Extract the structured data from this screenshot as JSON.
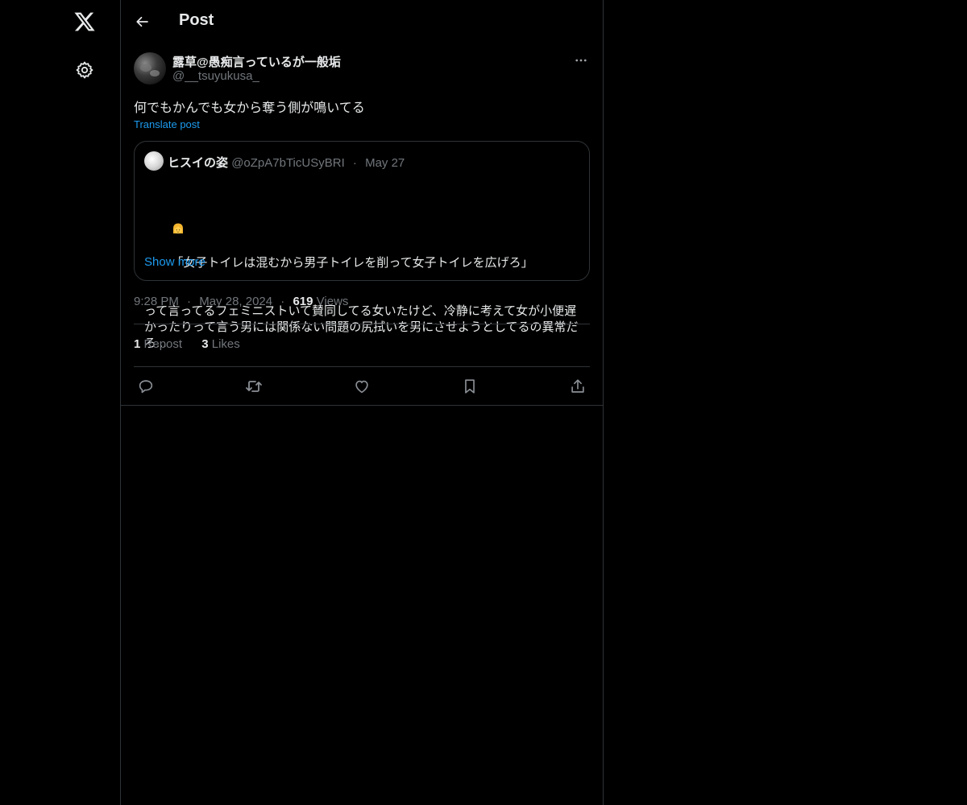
{
  "sidebar": {
    "logo_icon": "x-logo-icon",
    "settings_icon": "gear-icon"
  },
  "header": {
    "back_icon": "arrow-left-icon",
    "title": "Post"
  },
  "post": {
    "author_name": "露草@愚痴言っているが一般垢",
    "author_handle": "@__tsuyukusa_",
    "more_icon": "more-horizontal-icon",
    "text": "何でもかんでも女から奪う側が鳴いてる",
    "translate_label": "Translate post",
    "quote": {
      "name": "ヒスイの姿",
      "handle": "@oZpA7bTicUSyBRI",
      "date": "May 27",
      "line1": "「女子トイレは混むから男子トイレを削って女子トイレを広げろ」",
      "line2": "って言ってるフェミニストいて賛同してる女いたけど、冷静に考えて女が小便遅",
      "line3": "かったりって言う男には関係ない問題の尻拭いを男にさせようとしてるの異常だ",
      "line4": "ろ...",
      "show_more": "Show more"
    },
    "time": "9:28 PM",
    "date": "May 28, 2024",
    "views_count": "619",
    "views_label": "Views",
    "reposts_count": "1",
    "reposts_label": "Repost",
    "likes_count": "3",
    "likes_label": "Likes",
    "separator": "·"
  },
  "actions": [
    "reply-icon",
    "repost-icon",
    "like-icon",
    "bookmark-icon",
    "share-icon"
  ],
  "colors": {
    "background": "#000000",
    "text": "#e7e9ea",
    "muted": "#71767b",
    "accent": "#1d9bf0",
    "border": "#2f3336"
  }
}
